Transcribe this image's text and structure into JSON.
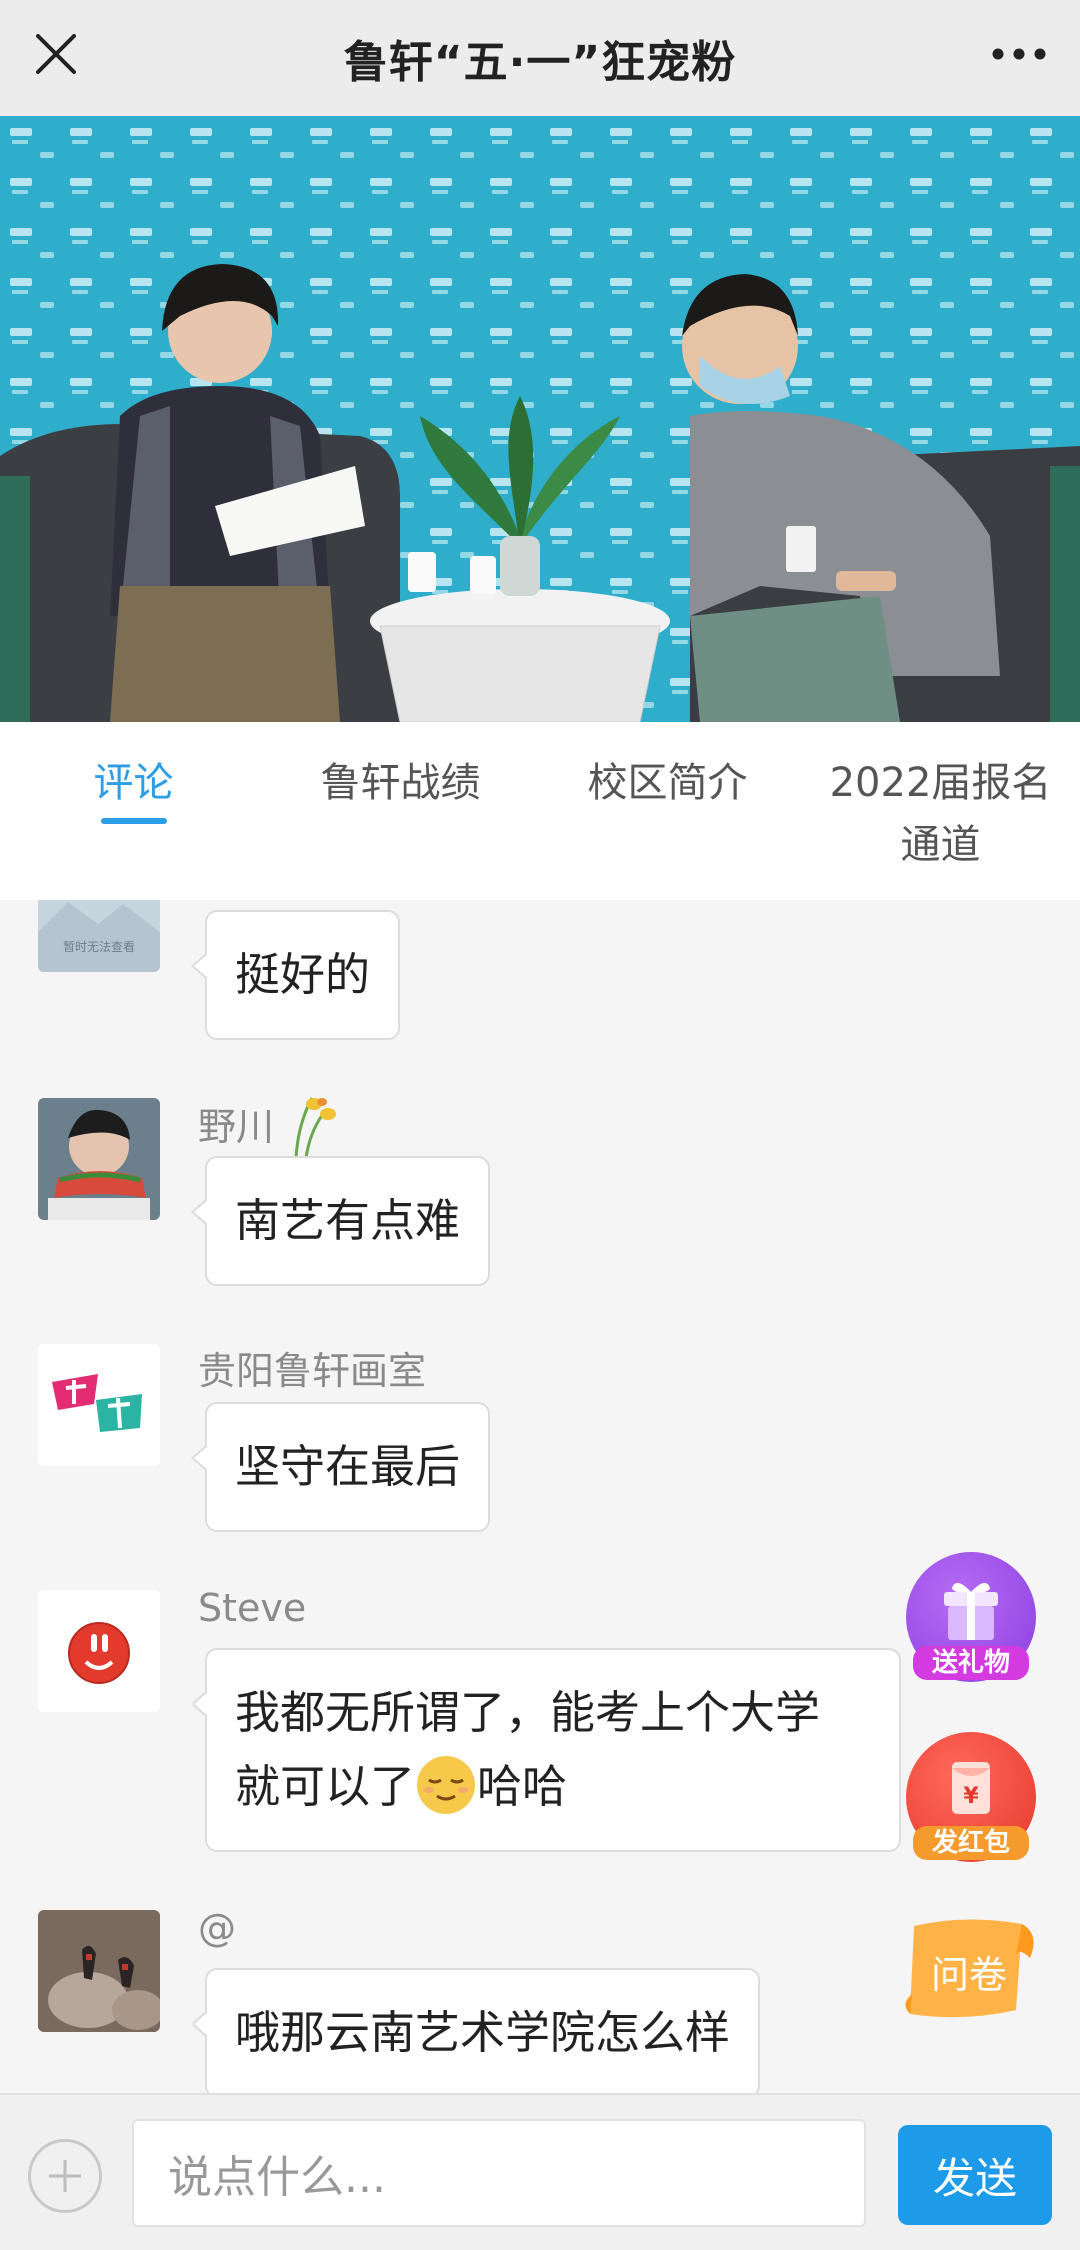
{
  "topbar": {
    "title": "鲁轩“五·一”狂宠粉"
  },
  "tabs": [
    {
      "label": "评论"
    },
    {
      "label": "鲁轩战绩"
    },
    {
      "label": "校区简介"
    },
    {
      "label": "2022届报名通道"
    }
  ],
  "messages": [
    {
      "user": "",
      "text": "挺好的",
      "avatar_note": "暂时无法查看"
    },
    {
      "user": "野川",
      "text": "南艺有点难"
    },
    {
      "user": "贵阳鲁轩画室",
      "text": "坚守在最后"
    },
    {
      "user": "Steve",
      "text_line1": "我都无所谓了，能考上个大学",
      "text_line2_a": "就可以了",
      "text_line2_b": "哈哈"
    },
    {
      "user": "@",
      "text": "哦那云南艺术学院怎么样"
    }
  ],
  "floats": {
    "gift": "送礼物",
    "redpacket": "发红包",
    "redpacket_symbol": "¥",
    "survey": "问卷"
  },
  "bottombar": {
    "placeholder": "说点什么...",
    "send": "发送"
  },
  "colors": {
    "accent": "#2d9de6",
    "send": "#1e9be8"
  }
}
